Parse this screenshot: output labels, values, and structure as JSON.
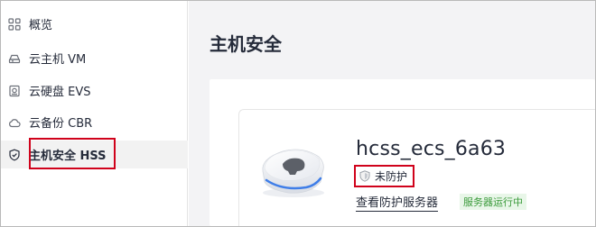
{
  "sidebar": {
    "items": [
      {
        "label": "概览",
        "icon": "grid-icon"
      },
      {
        "label": "云主机 VM",
        "icon": "host-icon"
      },
      {
        "label": "云硬盘 EVS",
        "icon": "disk-icon"
      },
      {
        "label": "云备份 CBR",
        "icon": "cloud-icon"
      },
      {
        "label": "主机安全 HSS",
        "icon": "shield-check-icon",
        "active": true
      }
    ]
  },
  "main": {
    "title": "主机安全",
    "host": {
      "name": "hcss_ecs_6a63",
      "protection_status": "未防护",
      "view_link": "查看防护服务器",
      "run_status": "服务器运行中"
    }
  },
  "colors": {
    "highlight": "#d0021b",
    "run_badge_bg": "#e8f6e8",
    "run_badge_text": "#3a9a3a",
    "main_bg": "#f3f3f5"
  }
}
